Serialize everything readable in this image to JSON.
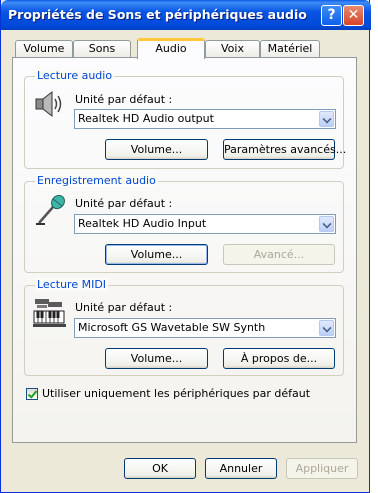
{
  "window": {
    "title": "Propriétés de Sons et périphériques audio",
    "help_button": "?",
    "close_button": "✕"
  },
  "tabs": [
    {
      "label": "Volume",
      "active": false
    },
    {
      "label": "Sons",
      "active": false
    },
    {
      "label": "Audio",
      "active": true
    },
    {
      "label": "Voix",
      "active": false
    },
    {
      "label": "Matériel",
      "active": false
    }
  ],
  "playback": {
    "group_label": "Lecture audio",
    "icon": "speaker-icon",
    "default_device_label": "Unité par défaut :",
    "selected_device": "Realtek HD Audio output",
    "volume_button": "Volume...",
    "advanced_button": "Paramètres avancés..."
  },
  "recording": {
    "group_label": "Enregistrement audio",
    "icon": "microphone-icon",
    "default_device_label": "Unité par défaut :",
    "selected_device": "Realtek HD Audio Input",
    "volume_button": "Volume...",
    "advanced_button": "Avancé..."
  },
  "midi": {
    "group_label": "Lecture MIDI",
    "icon": "midi-keyboard-icon",
    "default_device_label": "Unité par défaut :",
    "selected_device": "Microsoft GS Wavetable SW Synth",
    "volume_button": "Volume...",
    "about_button": "À propos de..."
  },
  "options": {
    "use_default_only_label": "Utiliser uniquement les périphériques par défaut",
    "use_default_only_checked": true
  },
  "footer": {
    "ok_button": "OK",
    "cancel_button": "Annuler",
    "apply_button": "Appliquer"
  },
  "colors": {
    "titlebar": "#0054e3",
    "group_label": "#0046d5",
    "active_tab_accent": "#ffc83c"
  }
}
